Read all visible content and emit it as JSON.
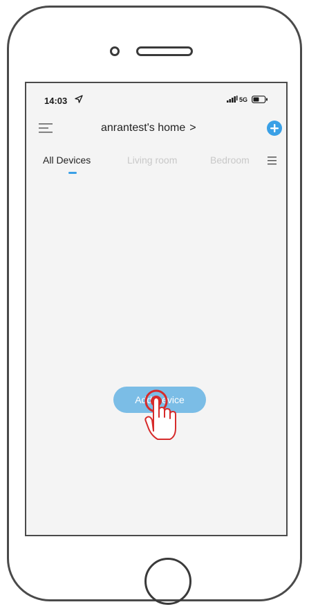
{
  "status_bar": {
    "time": "14:03",
    "network": "5G"
  },
  "header": {
    "home_name": "anrantest's home",
    "chevron": ">"
  },
  "tabs": [
    {
      "label": "All Devices",
      "active": true
    },
    {
      "label": "Living room",
      "active": false
    },
    {
      "label": "Bedroom",
      "active": false
    }
  ],
  "main": {
    "add_device_label": "Add Device"
  },
  "colors": {
    "accent": "#3aa0e6",
    "button": "#7bbde6",
    "tap_indicator": "#d62b2b",
    "screen_bg": "#f4f4f4"
  },
  "icons": {
    "menu": "menu-icon",
    "add": "plus-circle-icon",
    "tab_list": "list-icon",
    "location": "location-arrow-icon",
    "battery": "battery-icon",
    "tap_hint": "hand-tap-icon"
  }
}
